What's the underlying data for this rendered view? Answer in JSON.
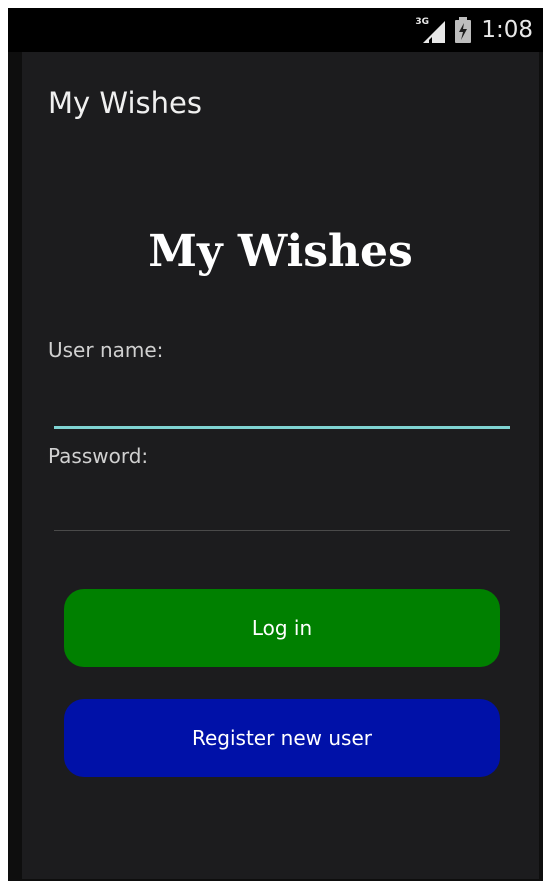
{
  "status_bar": {
    "network": "3G",
    "time": "1:08",
    "signal_icon": "cell-signal-icon",
    "battery_icon": "battery-charging-icon"
  },
  "action_bar": {
    "title": "My Wishes"
  },
  "main": {
    "title": "My Wishes",
    "username_label": "User name:",
    "username_value": "",
    "password_label": "Password:",
    "password_value": "",
    "login_label": "Log in",
    "register_label": "Register new user"
  },
  "colors": {
    "accent": "#7fd3d2",
    "login_button": "#008000",
    "register_button": "#0011a8",
    "background": "#1c1c1e"
  }
}
